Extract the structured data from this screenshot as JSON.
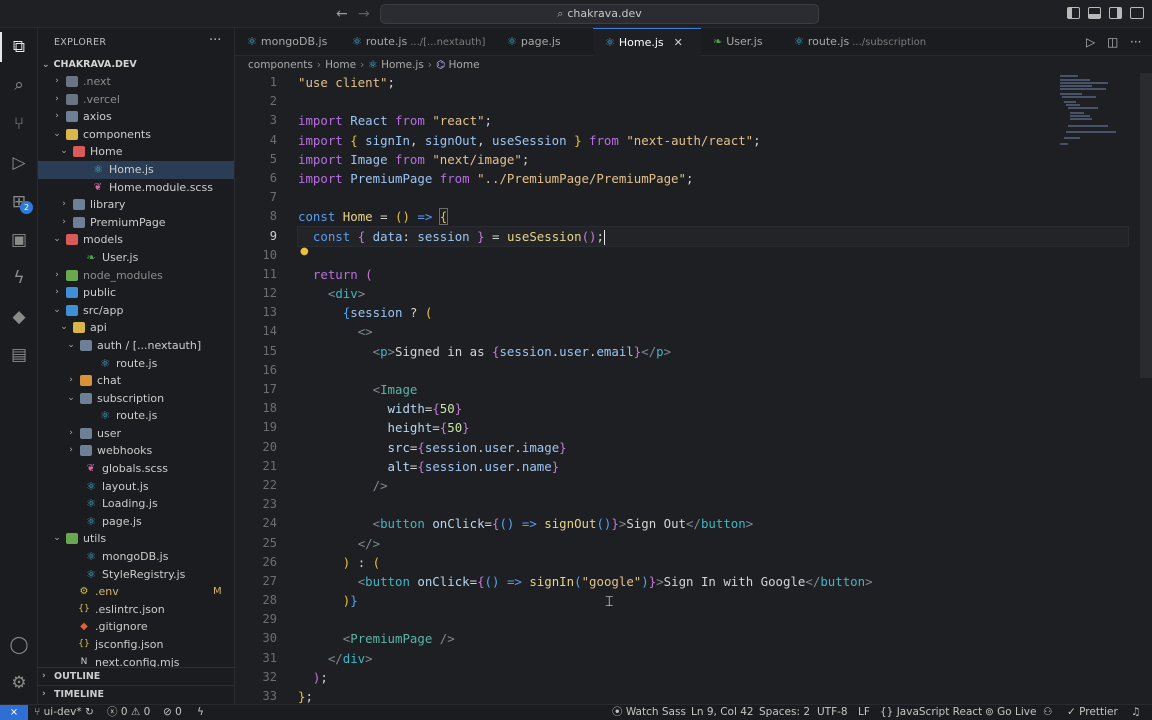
{
  "window": {
    "search_text": "chakrava.dev",
    "nav_back": "←",
    "nav_forward": "→"
  },
  "activity": {
    "explorer": "⧉",
    "search": "⌕",
    "source_control": "⑂",
    "run_debug": "▷",
    "extensions": "⊞",
    "extensions_badge": "2",
    "remote": "▣",
    "copilot": "ϟ",
    "docker": "◆",
    "chat": "▤",
    "accounts": "◯",
    "manage": "⚙"
  },
  "sidebar": {
    "title": "EXPLORER",
    "more": "···",
    "root": "CHAKRAVA.DEV",
    "items": [
      {
        "label": ".next",
        "depth": 0,
        "type": "folder",
        "state": "collapsed",
        "dim": true
      },
      {
        "label": ".vercel",
        "depth": 0,
        "type": "folder",
        "state": "collapsed",
        "dim": true
      },
      {
        "label": "axios",
        "depth": 0,
        "type": "folder",
        "state": "collapsed"
      },
      {
        "label": "components",
        "depth": 0,
        "type": "folder",
        "state": "expanded"
      },
      {
        "label": "Home",
        "depth": 1,
        "type": "folder",
        "state": "expanded"
      },
      {
        "label": "Home.js",
        "depth": 2,
        "type": "react",
        "selected": true
      },
      {
        "label": "Home.module.scss",
        "depth": 2,
        "type": "scss"
      },
      {
        "label": "library",
        "depth": 1,
        "type": "folder",
        "state": "collapsed"
      },
      {
        "label": "PremiumPage",
        "depth": 1,
        "type": "folder",
        "state": "collapsed"
      },
      {
        "label": "models",
        "depth": 0,
        "type": "folder",
        "state": "expanded"
      },
      {
        "label": "User.js",
        "depth": 1,
        "type": "leaf"
      },
      {
        "label": "node_modules",
        "depth": 0,
        "type": "folder",
        "state": "collapsed",
        "dim": true
      },
      {
        "label": "public",
        "depth": 0,
        "type": "folder",
        "state": "collapsed"
      },
      {
        "label": "src/app",
        "depth": 0,
        "type": "folder",
        "state": "expanded"
      },
      {
        "label": "api",
        "depth": 1,
        "type": "folder",
        "state": "expanded"
      },
      {
        "label": "auth / [...nextauth]",
        "depth": 2,
        "type": "folder",
        "state": "expanded"
      },
      {
        "label": "route.js",
        "depth": 3,
        "type": "react"
      },
      {
        "label": "chat",
        "depth": 2,
        "type": "folder",
        "state": "collapsed"
      },
      {
        "label": "subscription",
        "depth": 2,
        "type": "folder",
        "state": "expanded"
      },
      {
        "label": "route.js",
        "depth": 3,
        "type": "react"
      },
      {
        "label": "user",
        "depth": 2,
        "type": "folder",
        "state": "collapsed"
      },
      {
        "label": "webhooks",
        "depth": 2,
        "type": "folder",
        "state": "collapsed"
      },
      {
        "label": "globals.scss",
        "depth": 1,
        "type": "scss"
      },
      {
        "label": "layout.js",
        "depth": 1,
        "type": "react"
      },
      {
        "label": "Loading.js",
        "depth": 1,
        "type": "react"
      },
      {
        "label": "page.js",
        "depth": 1,
        "type": "react"
      },
      {
        "label": "utils",
        "depth": 0,
        "type": "folder",
        "state": "expanded"
      },
      {
        "label": "mongoDB.js",
        "depth": 1,
        "type": "react"
      },
      {
        "label": "StyleRegistry.js",
        "depth": 1,
        "type": "react"
      },
      {
        "label": ".env",
        "depth": 0,
        "type": "env",
        "yellow": true,
        "badge": "M"
      },
      {
        "label": ".eslintrc.json",
        "depth": 0,
        "type": "json"
      },
      {
        "label": ".gitignore",
        "depth": 0,
        "type": "git"
      },
      {
        "label": "jsconfig.json",
        "depth": 0,
        "type": "json"
      },
      {
        "label": "next.config.mjs",
        "depth": 0,
        "type": "config"
      }
    ],
    "outline": "OUTLINE",
    "timeline": "TIMELINE"
  },
  "tabs": [
    {
      "label": "mongoDB.js",
      "desc": "",
      "icon": "react"
    },
    {
      "label": "route.js",
      "desc": ".../[...nextauth]",
      "icon": "react"
    },
    {
      "label": "page.js",
      "desc": "",
      "icon": "react"
    },
    {
      "label": "Home.js",
      "desc": "",
      "icon": "react",
      "active": true
    },
    {
      "label": "User.js",
      "desc": "",
      "icon": "leaf"
    },
    {
      "label": "route.js",
      "desc": ".../subscription",
      "icon": "react"
    }
  ],
  "tab_close": "✕",
  "breadcrumb": [
    "components",
    "Home",
    "Home.js",
    "Home"
  ],
  "editor": {
    "line_numbers": [
      "1",
      "2",
      "3",
      "4",
      "5",
      "6",
      "7",
      "8",
      "9",
      "10",
      "11",
      "12",
      "13",
      "14",
      "15",
      "16",
      "17",
      "18",
      "19",
      "20",
      "21",
      "22",
      "23",
      "24",
      "25",
      "26",
      "27",
      "28",
      "29",
      "30",
      "31",
      "32",
      "33"
    ],
    "current_line": 9
  },
  "status": {
    "remote": "⨯",
    "branch": "ui-dev*",
    "sync": "↻",
    "errors": "0",
    "warnings": "0",
    "ports": "0",
    "watch_sass": "Watch Sass",
    "position": "Ln 9, Col 42",
    "spaces": "Spaces: 2",
    "encoding": "UTF-8",
    "eol": "LF",
    "language": "JavaScript React",
    "go_live": "Go Live",
    "prettier": "Prettier"
  },
  "colors": {
    "accent": "#3a7bd5",
    "react": "#49b5d6",
    "modified": "#d8b66a"
  }
}
